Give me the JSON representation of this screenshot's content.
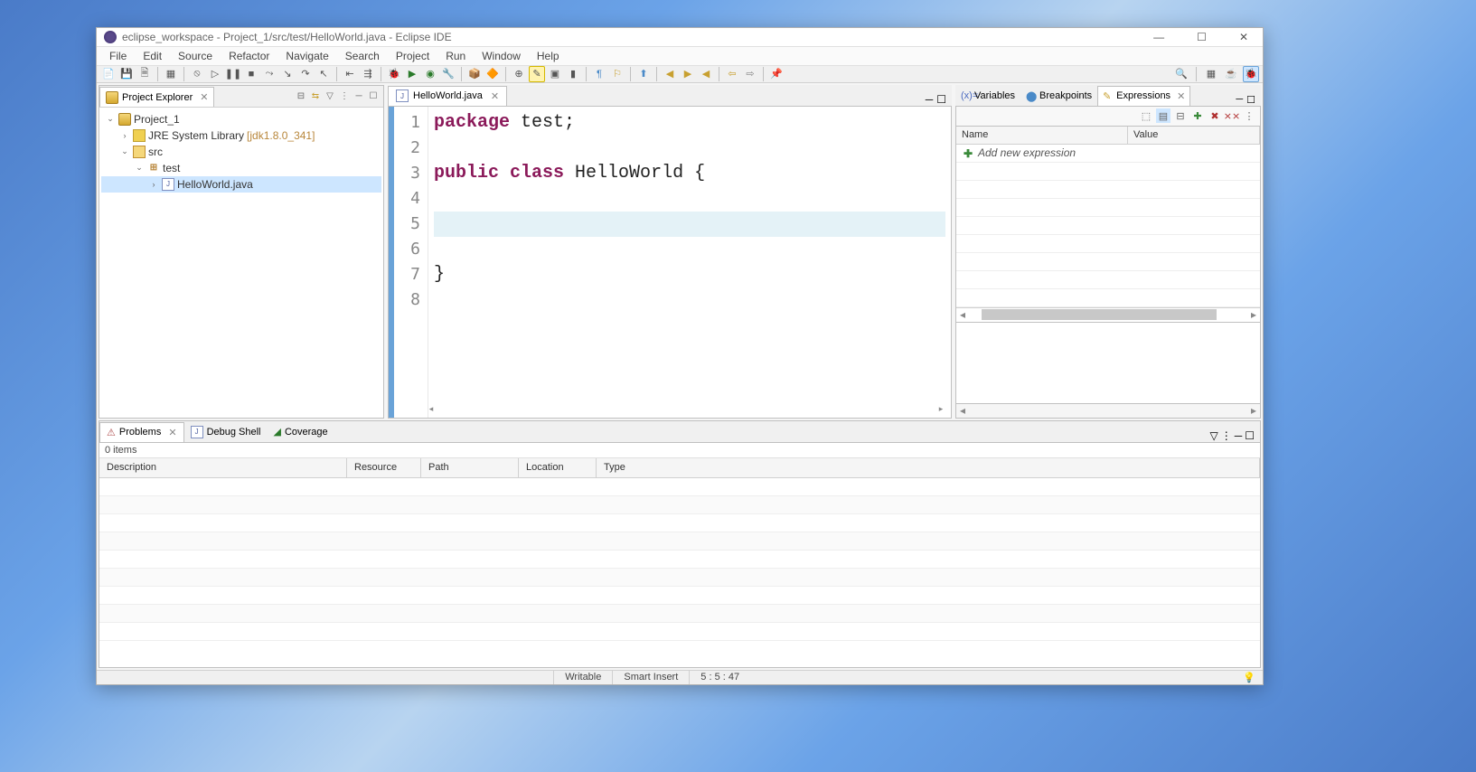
{
  "window": {
    "title": "eclipse_workspace - Project_1/src/test/HelloWorld.java - Eclipse IDE"
  },
  "menu": {
    "file": "File",
    "edit": "Edit",
    "source": "Source",
    "refactor": "Refactor",
    "navigate": "Navigate",
    "search": "Search",
    "project": "Project",
    "run": "Run",
    "window": "Window",
    "help": "Help"
  },
  "explorer": {
    "title": "Project Explorer",
    "tree": {
      "project": "Project_1",
      "jre_label": "JRE System Library",
      "jre_version": "[jdk1.8.0_341]",
      "src": "src",
      "pkg": "test",
      "file": "HelloWorld.java"
    }
  },
  "editor": {
    "tab": "HelloWorld.java",
    "lines": {
      "l1_kw": "package",
      "l1_rest": " test;",
      "l3_kw1": "public",
      "l3_kw2": "class",
      "l3_rest": " HelloWorld {",
      "l7": "}"
    },
    "linenums": {
      "n1": "1",
      "n2": "2",
      "n3": "3",
      "n4": "4",
      "n5": "5",
      "n6": "6",
      "n7": "7",
      "n8": "8"
    }
  },
  "right": {
    "tab_vars": "Variables",
    "tab_break": "Breakpoints",
    "tab_expr": "Expressions",
    "col_name": "Name",
    "col_value": "Value",
    "add_expr": "Add new expression"
  },
  "lower": {
    "tab_problems": "Problems",
    "tab_debug": "Debug Shell",
    "tab_coverage": "Coverage",
    "items": "0 items",
    "col_desc": "Description",
    "col_res": "Resource",
    "col_path": "Path",
    "col_loc": "Location",
    "col_type": "Type"
  },
  "status": {
    "writable": "Writable",
    "insert": "Smart Insert",
    "pos": "5 : 5 : 47"
  }
}
